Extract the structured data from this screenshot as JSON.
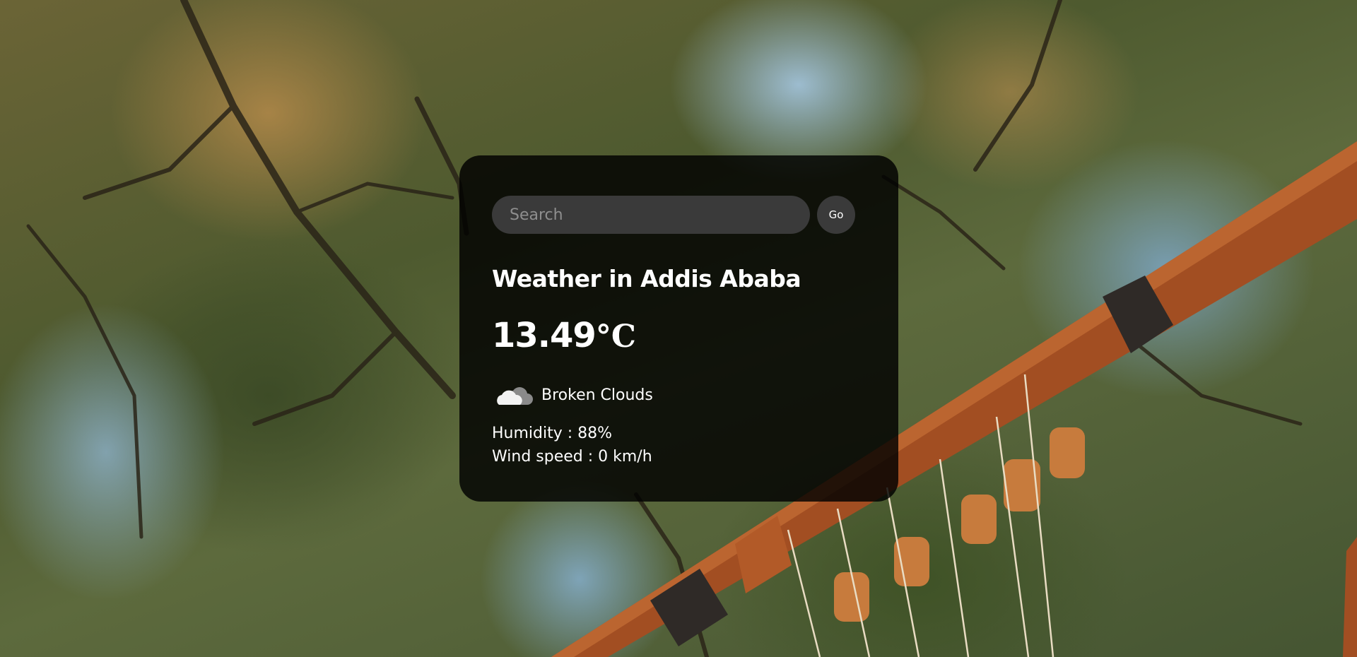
{
  "search": {
    "placeholder": "Search",
    "button_label": "Go"
  },
  "weather": {
    "title": "Weather in Addis Ababa",
    "temperature": "13.49",
    "unit": "°C",
    "icon": "broken-clouds-icon",
    "description": "Broken Clouds",
    "humidity_text": "Humidity : 88%",
    "wind_text": "Wind speed : 0 km/h"
  },
  "colors": {
    "card_background": "#000000",
    "text": "#ffffff",
    "input_background": "#3a3a3a",
    "wood_accent": "#a24e22"
  }
}
